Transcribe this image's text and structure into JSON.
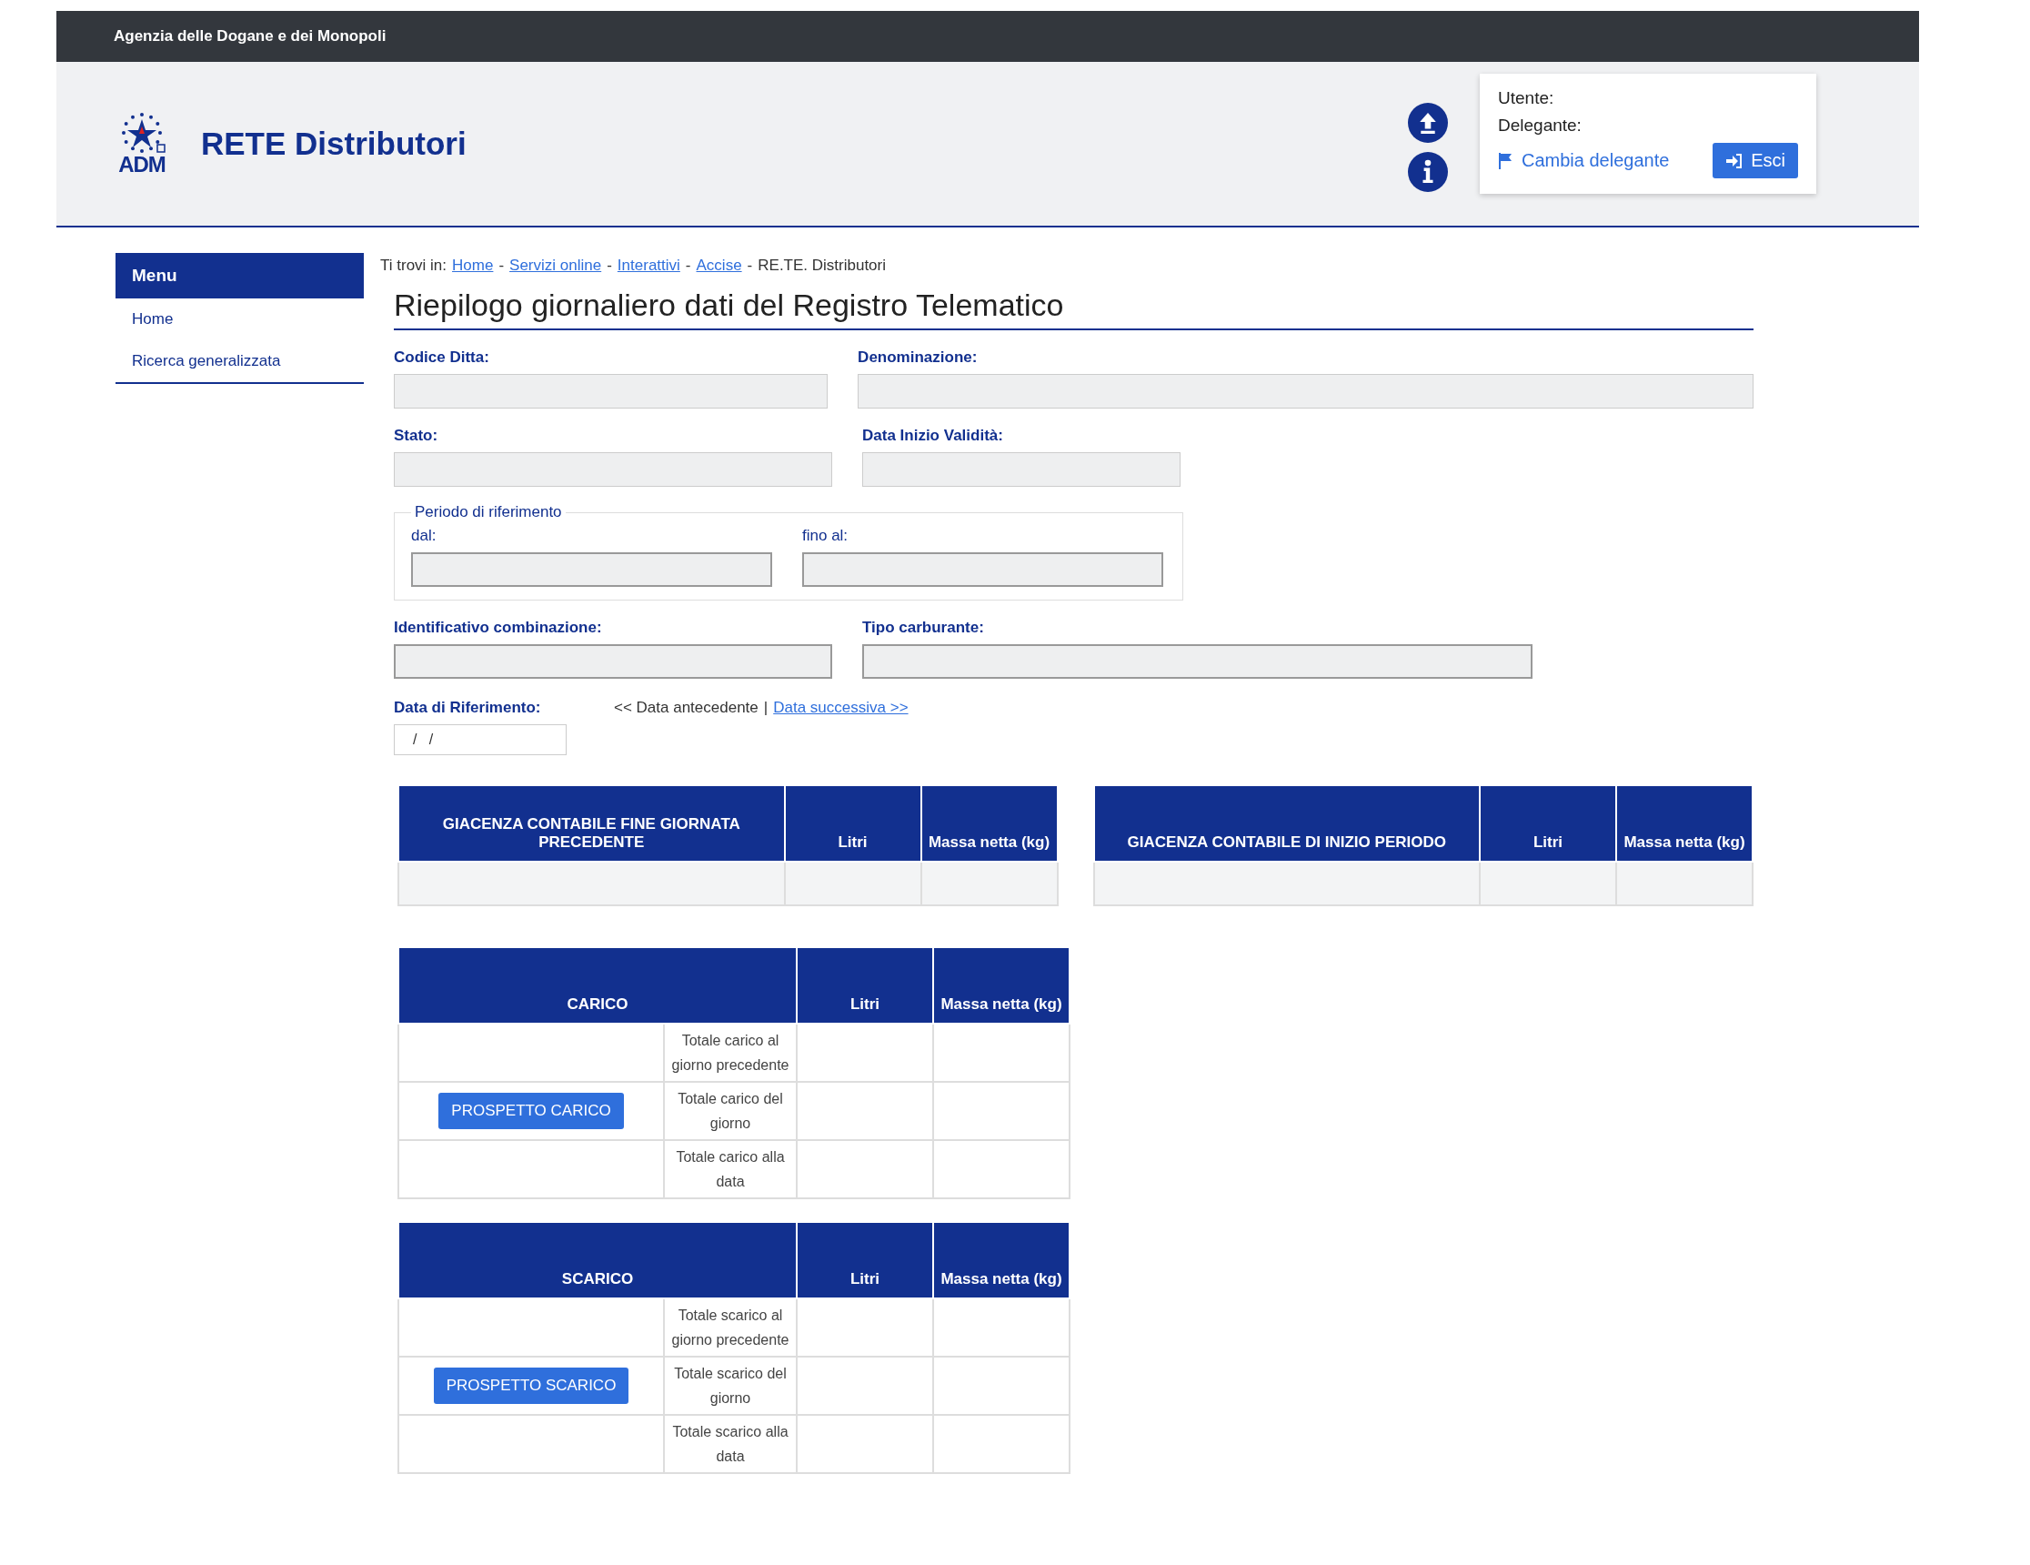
{
  "top_bar": {
    "title": "Agenzia delle Dogane e dei Monopoli"
  },
  "header": {
    "logo_text": "ADM",
    "app_title": "RETE Distributori",
    "user_label": "Utente:",
    "delegate_label": "Delegante:",
    "change_delegate": "Cambia delegante",
    "logout": "Esci"
  },
  "sidebar": {
    "title": "Menu",
    "items": [
      {
        "label": "Home"
      },
      {
        "label": "Ricerca generalizzata"
      }
    ]
  },
  "breadcrumb": {
    "prefix": "Ti trovi in:",
    "items": [
      {
        "kind": "link",
        "text": "Home"
      },
      {
        "kind": "sep",
        "text": "-"
      },
      {
        "kind": "link",
        "text": "Servizi online"
      },
      {
        "kind": "sep",
        "text": "-"
      },
      {
        "kind": "link",
        "text": "Interattivi"
      },
      {
        "kind": "sep",
        "text": "-"
      },
      {
        "kind": "link",
        "text": "Accise"
      },
      {
        "kind": "sep",
        "text": "-"
      },
      {
        "kind": "current",
        "text": "RE.TE. Distributori"
      }
    ]
  },
  "page_title": "Riepilogo giornaliero dati del Registro Telematico",
  "fields": {
    "codice_ditta": "Codice Ditta:",
    "denominazione": "Denominazione:",
    "stato": "Stato:",
    "data_inizio": "Data Inizio Validità:",
    "identificativo": "Identificativo combinazione:",
    "tipo_carburante": "Tipo carburante:"
  },
  "period": {
    "legend": "Periodo di riferimento",
    "from": "dal:",
    "to": "fino al:"
  },
  "reference_date": {
    "label": "Data di Riferimento:",
    "value": "/   /",
    "prev": "<< Data antecedente",
    "divider": "|",
    "next": "Data successiva >>"
  },
  "stock_tables": [
    {
      "columns": [
        "GIACENZA CONTABILE FINE GIORNATA PRECEDENTE",
        "Litri",
        "Massa netta (kg)"
      ]
    },
    {
      "columns": [
        "GIACENZA CONTABILE DI INIZIO PERIODO",
        "Litri",
        "Massa netta (kg)"
      ]
    }
  ],
  "movement_tables": [
    {
      "columns": [
        "CARICO",
        "Litri",
        "Massa netta (kg)"
      ],
      "rows": [
        {
          "label": "Totale carico al giorno precedente"
        },
        {
          "label": "Totale carico del giorno",
          "button": "PROSPETTO CARICO"
        },
        {
          "label": "Totale carico alla data"
        }
      ]
    },
    {
      "columns": [
        "SCARICO",
        "Litri",
        "Massa netta (kg)"
      ],
      "rows": [
        {
          "label": "Totale scarico al giorno precedente"
        },
        {
          "label": "Totale scarico del giorno",
          "button": "PROSPETTO SCARICO"
        },
        {
          "label": "Totale scarico alla data"
        }
      ]
    }
  ]
}
